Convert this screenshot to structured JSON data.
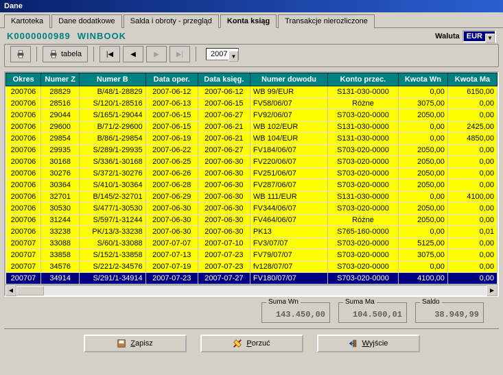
{
  "window": {
    "title": "Dane"
  },
  "tabs": [
    {
      "label": "Kartoteka"
    },
    {
      "label": "Dane dodatkowe"
    },
    {
      "label": "Salda i obroty - przegląd"
    },
    {
      "label": "Konta ksiąg",
      "active": true
    },
    {
      "label": "Transakcje nierozliczone"
    }
  ],
  "account": {
    "code": "K0000000989",
    "name": "WINBOOK"
  },
  "waluta": {
    "label": "Waluta",
    "value": "EUR"
  },
  "toolbar": {
    "tabela": "tabela",
    "year": "2007"
  },
  "columns": [
    "Okres",
    "Numer Z",
    "Numer B",
    "Data oper.",
    "Data księg.",
    "Numer dowodu",
    "Konto przec.",
    "Kwota Wn",
    "Kwota Ma"
  ],
  "rows": [
    {
      "okres": "200706",
      "numz": "28829",
      "numb": "B/48/1-28829",
      "dop": "2007-06-12",
      "dks": "2007-06-12",
      "dow": "WB 99/EUR",
      "konto": "S131-030-0000",
      "wn": "0,00",
      "ma": "6150,00",
      "sel": false
    },
    {
      "okres": "200706",
      "numz": "28516",
      "numb": "S/120/1-28516",
      "dop": "2007-06-13",
      "dks": "2007-06-15",
      "dow": "FV58/06/07",
      "konto": "Różne",
      "wn": "3075,00",
      "ma": "0,00",
      "sel": false
    },
    {
      "okres": "200706",
      "numz": "29044",
      "numb": "S/165/1-29044",
      "dop": "2007-06-15",
      "dks": "2007-06-27",
      "dow": "FV92/06/07",
      "konto": "S703-020-0000",
      "wn": "2050,00",
      "ma": "0,00",
      "sel": false
    },
    {
      "okres": "200706",
      "numz": "29600",
      "numb": "B/71/2-29600",
      "dop": "2007-06-15",
      "dks": "2007-06-21",
      "dow": "WB 102/EUR",
      "konto": "S131-030-0000",
      "wn": "0,00",
      "ma": "2425,00",
      "sel": false
    },
    {
      "okres": "200706",
      "numz": "29854",
      "numb": "B/86/1-29854",
      "dop": "2007-06-19",
      "dks": "2007-06-21",
      "dow": "WB 104/EUR",
      "konto": "S131-030-0000",
      "wn": "0,00",
      "ma": "4850,00",
      "sel": false
    },
    {
      "okres": "200706",
      "numz": "29935",
      "numb": "S/289/1-29935",
      "dop": "2007-06-22",
      "dks": "2007-06-27",
      "dow": "FV184/06/07",
      "konto": "S703-020-0000",
      "wn": "2050,00",
      "ma": "0,00",
      "sel": false
    },
    {
      "okres": "200706",
      "numz": "30168",
      "numb": "S/336/1-30168",
      "dop": "2007-06-25",
      "dks": "2007-06-30",
      "dow": "FV220/06/07",
      "konto": "S703-020-0000",
      "wn": "2050,00",
      "ma": "0,00",
      "sel": false
    },
    {
      "okres": "200706",
      "numz": "30276",
      "numb": "S/372/1-30276",
      "dop": "2007-06-26",
      "dks": "2007-06-30",
      "dow": "FV251/06/07",
      "konto": "S703-020-0000",
      "wn": "2050,00",
      "ma": "0,00",
      "sel": false
    },
    {
      "okres": "200706",
      "numz": "30364",
      "numb": "S/410/1-30364",
      "dop": "2007-06-28",
      "dks": "2007-06-30",
      "dow": "FV287/06/07",
      "konto": "S703-020-0000",
      "wn": "2050,00",
      "ma": "0,00",
      "sel": false
    },
    {
      "okres": "200706",
      "numz": "32701",
      "numb": "B/145/2-32701",
      "dop": "2007-06-29",
      "dks": "2007-06-30",
      "dow": "WB 111/EUR",
      "konto": "S131-030-0000",
      "wn": "0,00",
      "ma": "4100,00",
      "sel": false
    },
    {
      "okres": "200706",
      "numz": "30530",
      "numb": "S/477/1-30530",
      "dop": "2007-06-30",
      "dks": "2007-06-30",
      "dow": "FV344/06/07",
      "konto": "S703-020-0000",
      "wn": "2050,00",
      "ma": "0,00",
      "sel": false
    },
    {
      "okres": "200706",
      "numz": "31244",
      "numb": "S/597/1-31244",
      "dop": "2007-06-30",
      "dks": "2007-06-30",
      "dow": "FV464/06/07",
      "konto": "Różne",
      "wn": "2050,00",
      "ma": "0,00",
      "sel": false
    },
    {
      "okres": "200706",
      "numz": "33238",
      "numb": "PK/13/3-33238",
      "dop": "2007-06-30",
      "dks": "2007-06-30",
      "dow": "PK13",
      "konto": "S765-160-0000",
      "wn": "0,00",
      "ma": "0,01",
      "sel": false
    },
    {
      "okres": "200707",
      "numz": "33088",
      "numb": "S/60/1-33088",
      "dop": "2007-07-07",
      "dks": "2007-07-10",
      "dow": "FV3/07/07",
      "konto": "S703-020-0000",
      "wn": "5125,00",
      "ma": "0,00",
      "sel": false
    },
    {
      "okres": "200707",
      "numz": "33858",
      "numb": "S/152/1-33858",
      "dop": "2007-07-13",
      "dks": "2007-07-23",
      "dow": "FV79/07/07",
      "konto": "S703-020-0000",
      "wn": "3075,00",
      "ma": "0,00",
      "sel": false
    },
    {
      "okres": "200707",
      "numz": "34576",
      "numb": "S/221/2-34576",
      "dop": "2007-07-19",
      "dks": "2007-07-23",
      "dow": "fv128/07/07",
      "konto": "S703-020-0000",
      "wn": "0,00",
      "ma": "0,00",
      "sel": false
    },
    {
      "okres": "200707",
      "numz": "34914",
      "numb": "S/291/1-34914",
      "dop": "2007-07-23",
      "dks": "2007-07-27",
      "dow": "FV180/07/07",
      "konto": "S703-020-0000",
      "wn": "4100,00",
      "ma": "0,00",
      "sel": true
    }
  ],
  "totals": {
    "suma_wn": {
      "label": "Suma Wn",
      "value": "143.450,00"
    },
    "suma_ma": {
      "label": "Suma Ma",
      "value": "104.500,01"
    },
    "saldo": {
      "label": "Saldo",
      "value": "38.949,99"
    }
  },
  "buttons": {
    "zapisz": "Zapisz",
    "porzuc": "Porzuć",
    "wyjscie": "Wyjście"
  }
}
